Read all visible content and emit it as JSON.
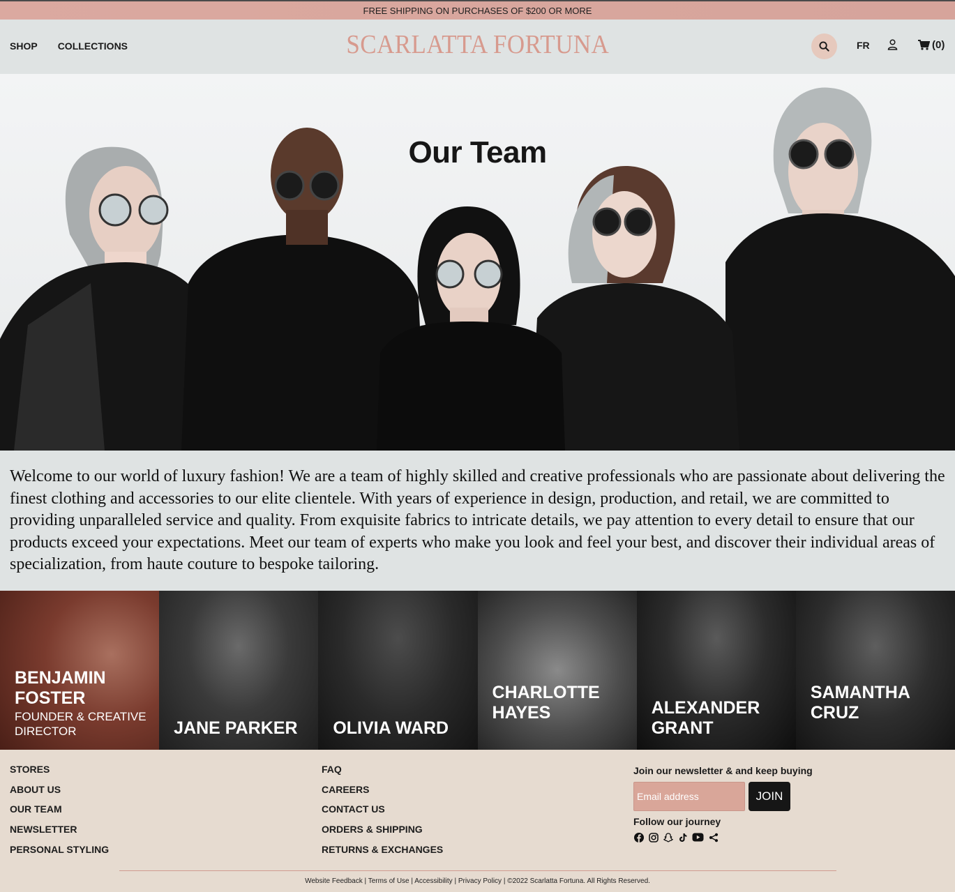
{
  "promo": {
    "text": "FREE SHIPPING ON PURCHASES OF $200 OR MORE"
  },
  "header": {
    "nav": [
      {
        "label": "SHOP"
      },
      {
        "label": "COLLECTIONS"
      }
    ],
    "brand": "SCARLATTA FORTUNA",
    "lang": "FR",
    "cart_count": "(0)",
    "icons": {
      "search": "search-icon",
      "account": "user-icon",
      "cart": "cart-icon"
    }
  },
  "hero": {
    "title": "Our Team"
  },
  "intro": {
    "text": "Welcome to our world of luxury fashion! We are a team of highly skilled and creative professionals who are passionate about delivering the finest clothing and accessories to our elite clientele. With years of experience in design, production, and retail, we are committed to providing unparalleled service and quality. From exquisite fabrics to intricate details, we pay attention to every detail to ensure that our products exceed your expectations. Meet our team of experts who make you look and feel your best, and discover their individual areas of specialization, from haute couture to bespoke tailoring."
  },
  "team": [
    {
      "name": "BENJAMIN FOSTER",
      "role": "FOUNDER & CREATIVE DIRECTOR"
    },
    {
      "name": "JANE PARKER",
      "role": ""
    },
    {
      "name": "OLIVIA WARD",
      "role": ""
    },
    {
      "name": "CHARLOTTE HAYES",
      "role": ""
    },
    {
      "name": "ALEXANDER GRANT",
      "role": ""
    },
    {
      "name": "SAMANTHA CRUZ",
      "role": ""
    }
  ],
  "footer": {
    "col1": [
      "STORES",
      "ABOUT US",
      "OUR TEAM",
      "NEWSLETTER",
      "PERSONAL STYLING"
    ],
    "col2": [
      "FAQ",
      "CAREERS",
      "CONTACT US",
      "ORDERS & SHIPPING",
      "RETURNS & EXCHANGES"
    ],
    "newsletter": {
      "title": "Join our newsletter & and keep buying",
      "placeholder": "Email address",
      "button": "JOIN"
    },
    "follow": "Follow our journey",
    "socials": [
      "facebook-icon",
      "instagram-icon",
      "snapchat-icon",
      "tiktok-icon",
      "youtube-icon",
      "share-icon"
    ],
    "legal": "Website Feedback | Terms of Use | Accessibility | Privacy Policy | ©2022 Scarlatta Fortuna. All Rights Reserved."
  },
  "colors": {
    "accent": "#d79a8e",
    "header_bg": "#dfe3e3",
    "footer_bg": "#e6dbd0",
    "dark": "#161616"
  }
}
